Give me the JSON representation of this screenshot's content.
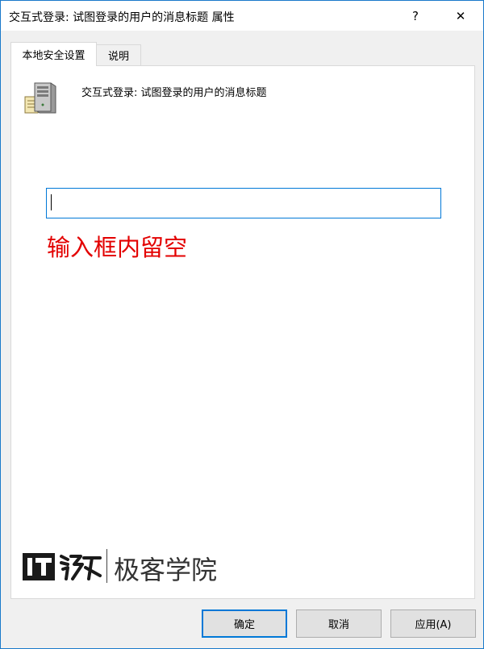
{
  "window": {
    "title": "交互式登录: 试图登录的用户的消息标题 属性",
    "help_label": "?",
    "close_label": "✕"
  },
  "tabs": [
    {
      "label": "本地安全设置",
      "active": true
    },
    {
      "label": "说明",
      "active": false
    }
  ],
  "policy": {
    "icon": "server-icon",
    "title": "交互式登录: 试图登录的用户的消息标题"
  },
  "message_input": {
    "value": "",
    "placeholder": ""
  },
  "annotation": {
    "text": "输入框内留空",
    "color": "#e30000"
  },
  "watermark": {
    "logo_letters": "IT之家",
    "text": "极客学院"
  },
  "buttons": {
    "ok": "确定",
    "cancel": "取消",
    "apply": "应用(A)"
  },
  "colors": {
    "accent": "#0078d7",
    "window_border": "#1979ca"
  }
}
